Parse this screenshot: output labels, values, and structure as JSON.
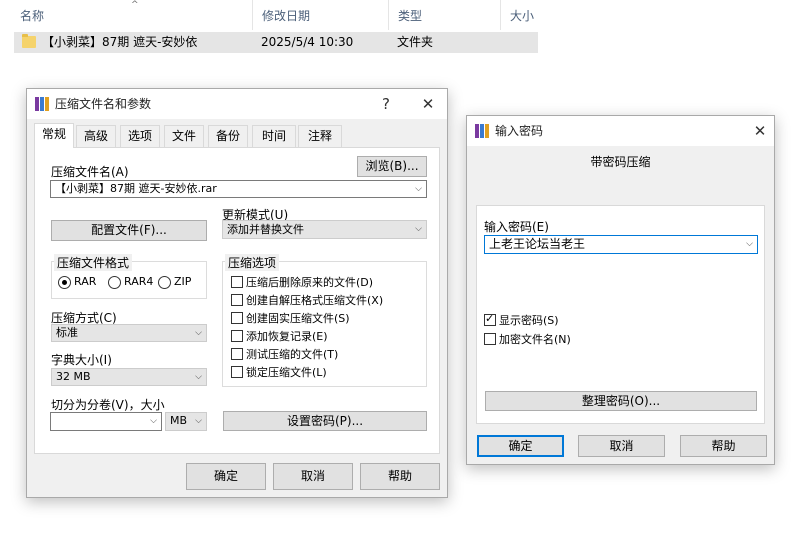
{
  "explorer": {
    "columns": {
      "name": "名称",
      "modified": "修改日期",
      "type": "类型",
      "size": "大小"
    },
    "row": {
      "name": "【小剥菜】87期 遮天-安妙依",
      "modified": "2025/5/4 10:30",
      "type": "文件夹"
    }
  },
  "compress_dialog": {
    "title": "压缩文件名和参数",
    "help_glyph": "?",
    "close_glyph": "✕",
    "tabs": [
      "常规",
      "高级",
      "选项",
      "文件",
      "备份",
      "时间",
      "注释"
    ],
    "archive_name_label": "压缩文件名(A)",
    "archive_name_value": "【小剥菜】87期 遮天-安妙依.rar",
    "browse_button": "浏览(B)...",
    "profiles_button": "配置文件(F)...",
    "update_mode_label": "更新模式(U)",
    "update_mode_value": "添加并替换文件",
    "format_group_title": "压缩文件格式",
    "formats": [
      "RAR",
      "RAR4",
      "ZIP"
    ],
    "options_group_title": "压缩选项",
    "options": [
      "压缩后删除原来的文件(D)",
      "创建自解压格式压缩文件(X)",
      "创建固实压缩文件(S)",
      "添加恢复记录(E)",
      "测试压缩的文件(T)",
      "锁定压缩文件(L)"
    ],
    "method_label": "压缩方式(C)",
    "method_value": "标准",
    "dict_label": "字典大小(I)",
    "dict_value": "32 MB",
    "split_label": "切分为分卷(V)，大小",
    "split_value": "",
    "split_unit": "MB",
    "set_password_button": "设置密码(P)...",
    "ok_button": "确定",
    "cancel_button": "取消",
    "help_button": "帮助"
  },
  "password_dialog": {
    "title": "输入密码",
    "close_glyph": "✕",
    "subtitle": "带密码压缩",
    "password_label": "输入密码(E)",
    "password_value": "上老王论坛当老王",
    "show_password_label": "显示密码(S)",
    "show_password_checked": true,
    "encrypt_names_label": "加密文件名(N)",
    "encrypt_names_checked": false,
    "organize_button": "整理密码(O)...",
    "ok_button": "确定",
    "cancel_button": "取消",
    "help_button": "帮助"
  },
  "icons": {
    "sort_arrow": "^",
    "chevron": "⌵",
    "winrar_colors": [
      "#7a3aa0",
      "#3a7ad0",
      "#e0a020"
    ]
  }
}
